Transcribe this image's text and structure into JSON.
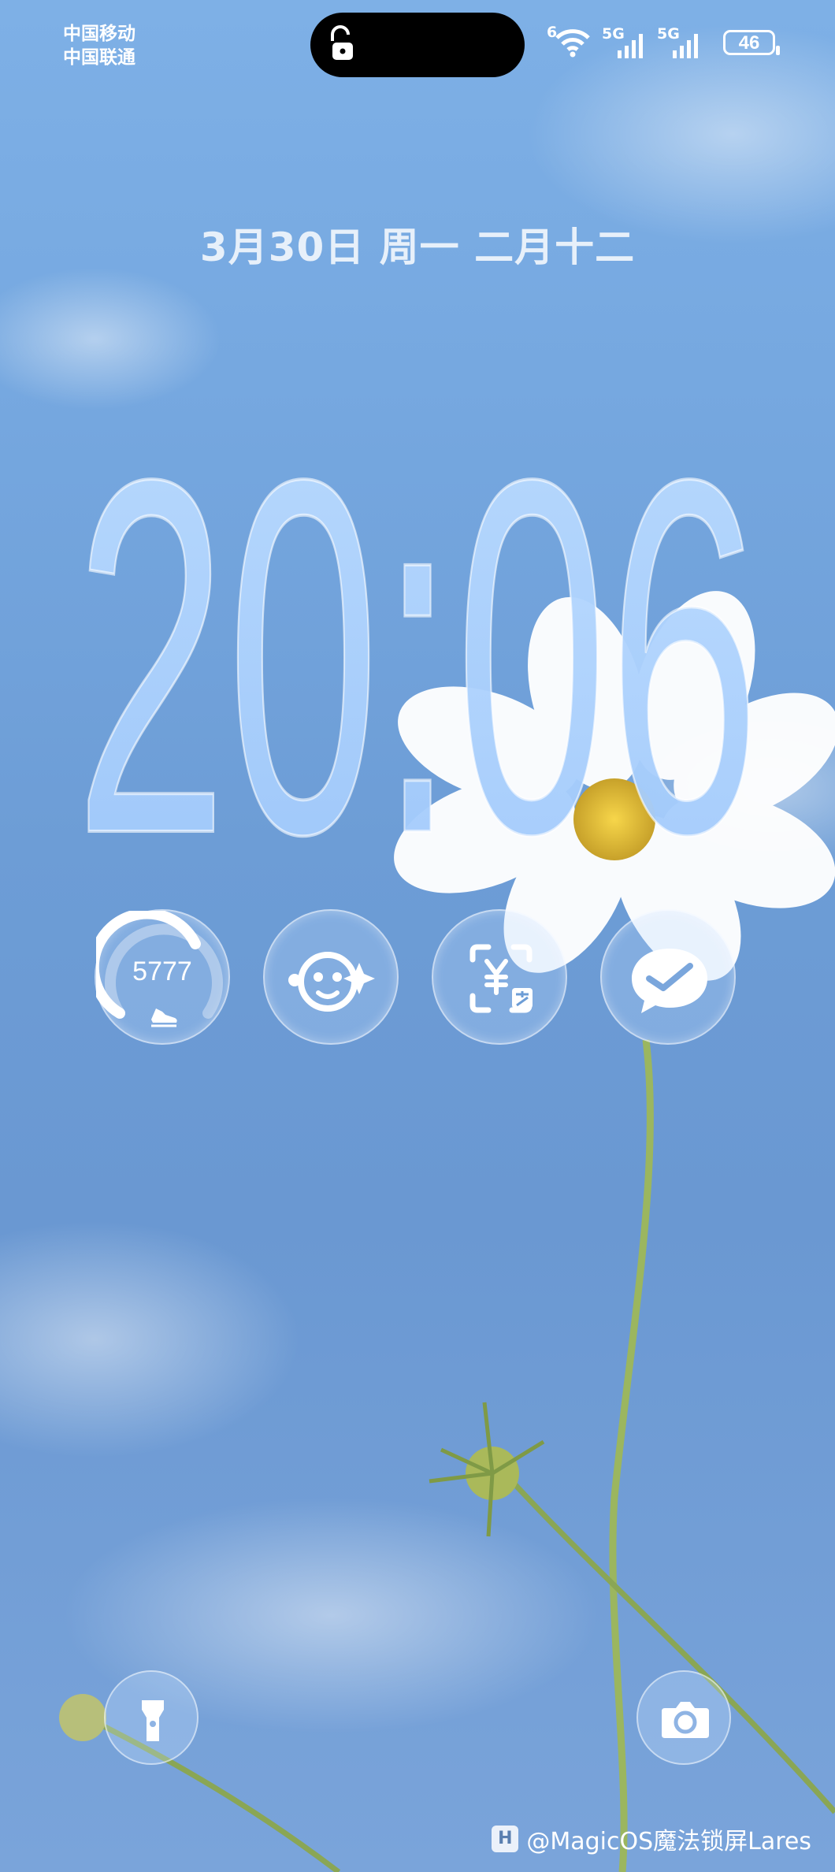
{
  "status_bar": {
    "carrier_1": "中国移动",
    "carrier_2": "中国联通",
    "wifi_label": "6",
    "sim1_label": "5G",
    "sim2_label": "5G",
    "battery_level": "46"
  },
  "lockscreen": {
    "date": "3月30日 周一 二月十二",
    "time": "20:06"
  },
  "widgets": {
    "steps": {
      "value": "5777",
      "icon": "shoe-icon"
    },
    "assistant_icon": "assistant-face-icon",
    "payment_icon": "payment-code-icon",
    "wechat_icon": "wechat-icon"
  },
  "shortcuts": {
    "left": "flashlight-icon",
    "right": "camera-icon"
  },
  "watermark": {
    "badge": "H",
    "text": "@MagicOS魔法锁屏Lares"
  },
  "colors": {
    "sky": "#6d9dd6",
    "clock_fill": "#a8cdfb"
  }
}
